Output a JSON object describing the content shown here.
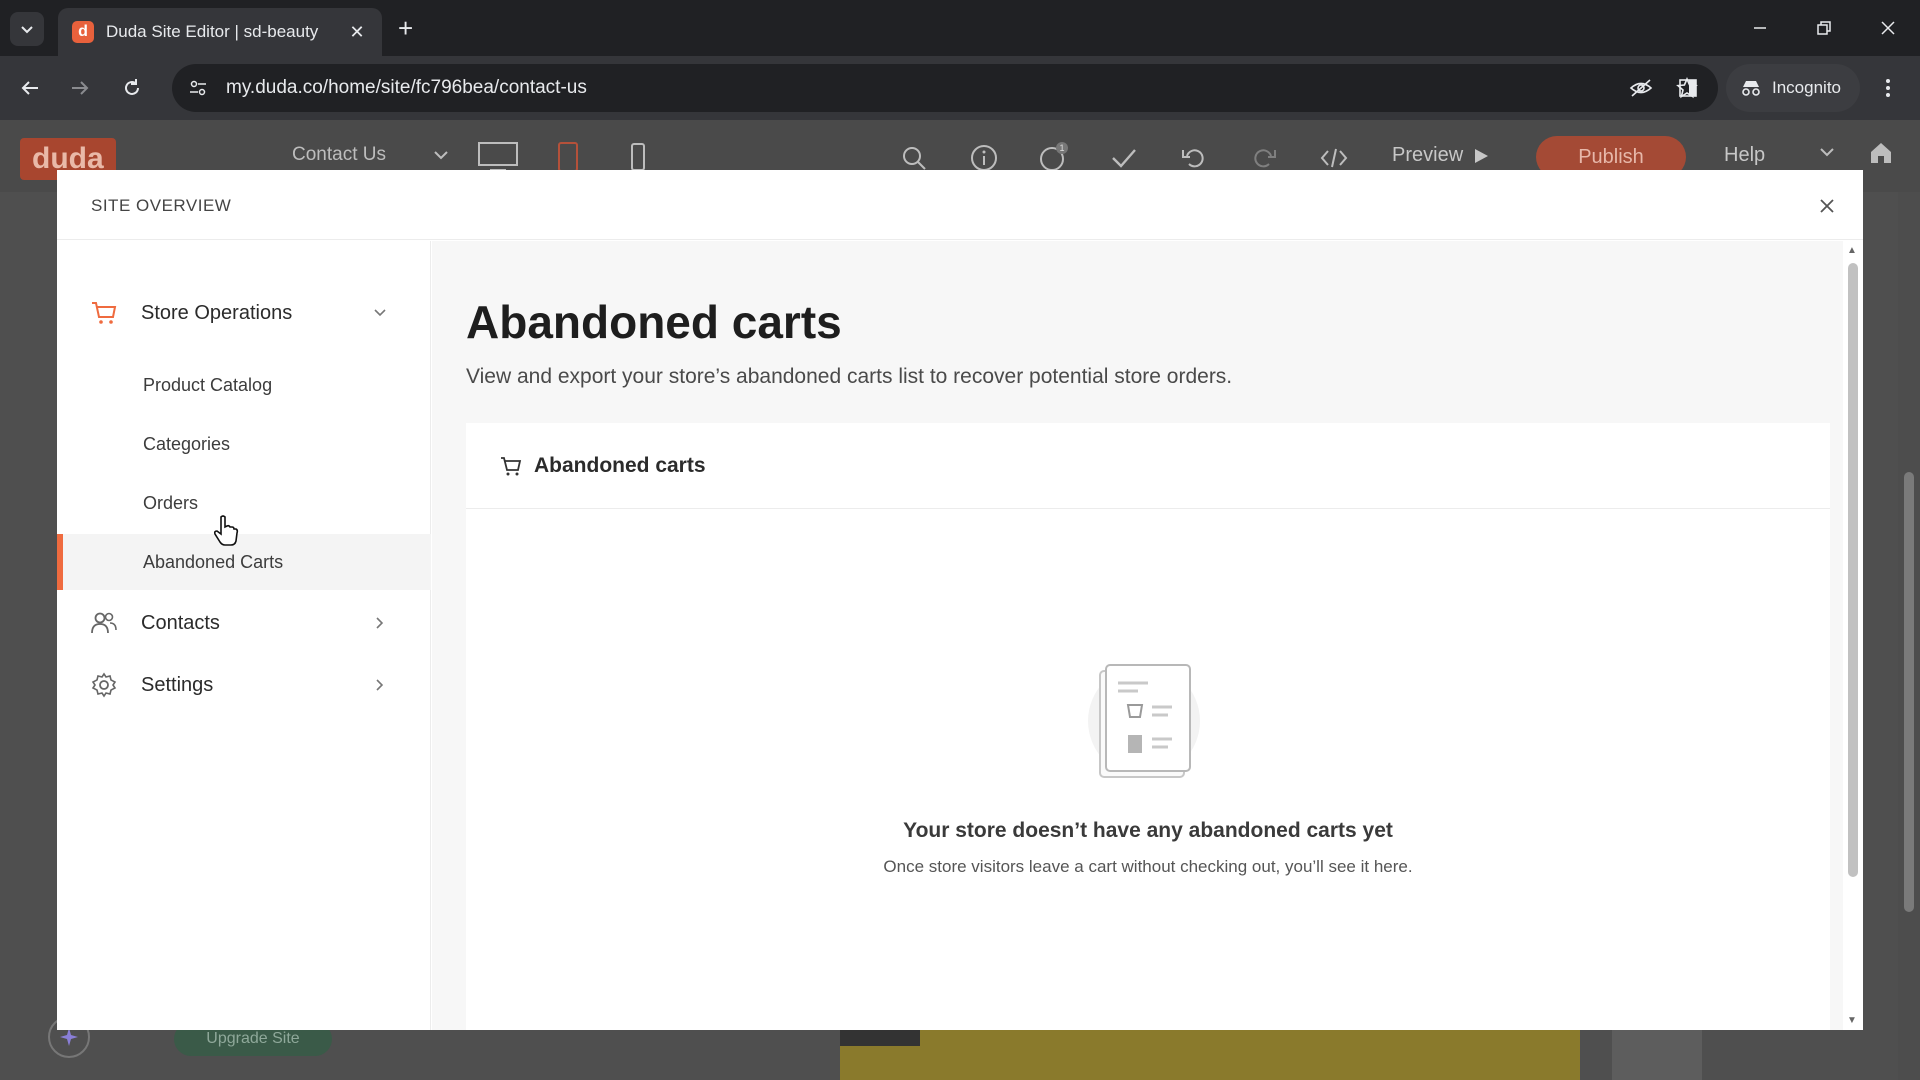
{
  "browser": {
    "tab_title": "Duda Site Editor | sd-beauty",
    "tab_favicon_letter": "d",
    "url": "my.duda.co/home/site/fc796bea/contact-us",
    "incognito_label": "Incognito"
  },
  "editor": {
    "logo": "duda",
    "page_selector": "Contact Us",
    "preview_label": "Preview",
    "publish_label": "Publish",
    "help_label": "Help",
    "notification_count": "1",
    "upgrade_label": "Upgrade Site",
    "colors": {
      "publish": "#f0623a",
      "accent": "#ef6b3f"
    }
  },
  "modal": {
    "title": "SITE OVERVIEW",
    "sidebar": {
      "store_operations": {
        "label": "Store Operations",
        "icon": "cart-icon",
        "items": [
          {
            "label": "Product Catalog"
          },
          {
            "label": "Categories"
          },
          {
            "label": "Orders"
          },
          {
            "label": "Abandoned Carts",
            "active": true
          }
        ]
      },
      "contacts": {
        "label": "Contacts",
        "icon": "people-icon"
      },
      "settings": {
        "label": "Settings",
        "icon": "gear-icon"
      }
    },
    "main": {
      "title": "Abandoned carts",
      "subtitle": "View and export your store’s abandoned carts list to recover potential store orders.",
      "card_title": "Abandoned carts",
      "empty_title": "Your store doesn’t have any abandoned carts yet",
      "empty_subtitle": "Once store visitors leave a cart without checking out, you’ll see it here."
    }
  }
}
